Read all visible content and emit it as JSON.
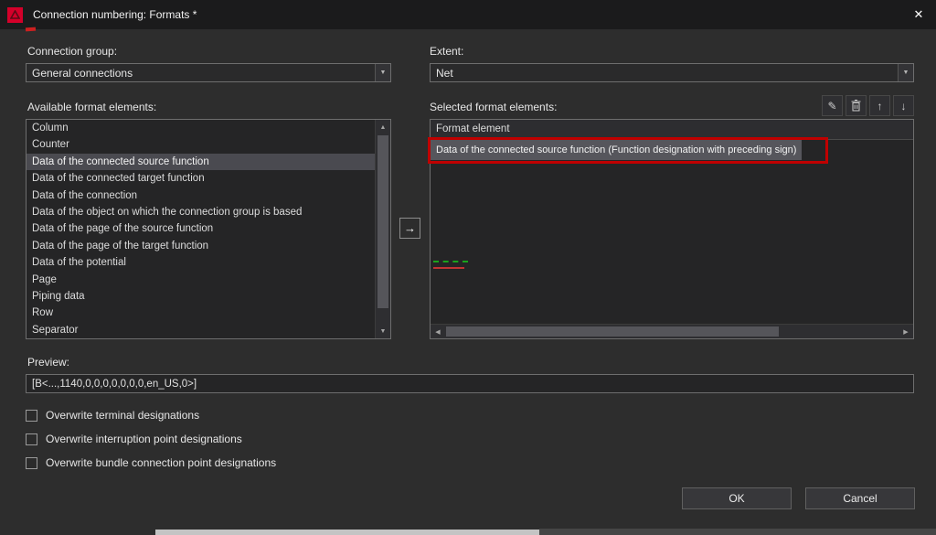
{
  "window": {
    "title": "Connection numbering: Formats *"
  },
  "icons": {
    "close": "✕",
    "dropdown": "▼",
    "scroll_up": "▲",
    "scroll_down": "▼",
    "scroll_left": "◀",
    "scroll_right": "▶",
    "edit": "✎",
    "move_up": "↑",
    "move_down": "↓",
    "transfer_right": "→"
  },
  "connection_group": {
    "label": "Connection group:",
    "value": "General connections"
  },
  "extent": {
    "label": "Extent:",
    "value": "Net"
  },
  "available": {
    "label": "Available format elements:",
    "selected_index": 2,
    "items": [
      "Column",
      "Counter",
      "Data of the connected source function",
      "Data of the connected target function",
      "Data of the connection",
      "Data of the object on which the connection group is based",
      "Data of the page of the source function",
      "Data of the page of the target function",
      "Data of the potential",
      "Page",
      "Piping data",
      "Row",
      "Separator"
    ]
  },
  "selected_elements": {
    "label": "Selected format elements:",
    "header": "Format element",
    "selected_index": 0,
    "rows": [
      "Data of the connected source function (Function designation with preceding sign)"
    ]
  },
  "preview": {
    "label": "Preview:",
    "value": "[B<...,1140,0,0,0,0,0,0,0,en_US,0>]"
  },
  "options": [
    {
      "label": "Overwrite terminal designations",
      "checked": false
    },
    {
      "label": "Overwrite interruption point designations",
      "checked": false
    },
    {
      "label": "Overwrite bundle connection point designations",
      "checked": false
    }
  ],
  "actions": {
    "ok": "OK",
    "cancel": "Cancel"
  },
  "colors": {
    "titlebar": "#1b1b1c",
    "dialog_bg": "#2d2d2d",
    "logo_red": "#d4002a",
    "annotation_red": "#c00000"
  }
}
